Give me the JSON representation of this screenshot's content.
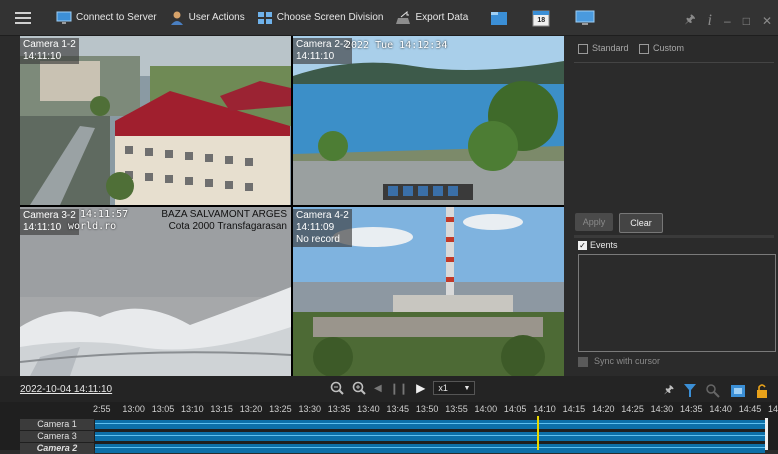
{
  "toolbar": {
    "connect_label": "Connect to Server",
    "user_actions_label": "User Actions",
    "screen_division_label": "Choose Screen Division",
    "export_label": "Export Data",
    "calendar_day": "18"
  },
  "cameras": [
    {
      "label": "Camera 1-2",
      "time": "14:11:10"
    },
    {
      "label": "Camera 2-2",
      "time": "14:11:10",
      "osd": "2022 Tue 14:12:34"
    },
    {
      "label": "Camera 3-2",
      "time": "14:11:10",
      "osd_left": "14:11:57",
      "osd_left2": "world.ro",
      "osd_right": "BAZA SALVAMONT ARGES",
      "osd_right2": "Cota 2000 Transfagarasan"
    },
    {
      "label": "Camera 4-2",
      "time": "14:11:09",
      "status": "No record"
    }
  ],
  "side": {
    "standard_label": "Standard",
    "custom_label": "Custom",
    "apply_label": "Apply",
    "clear_label": "Clear",
    "events_label": "Events",
    "sync_label": "Sync with cursor"
  },
  "playback": {
    "datetime": "2022-10-04 14:11:10",
    "speed": "x1"
  },
  "timeline": {
    "ticks": [
      "2:55",
      "13:00",
      "13:05",
      "13:10",
      "13:15",
      "13:20",
      "13:25",
      "13:30",
      "13:35",
      "13:40",
      "13:45",
      "13:50",
      "13:55",
      "14:00",
      "14:05",
      "14:10",
      "14:15",
      "14:20",
      "14:25",
      "14:30",
      "14:35",
      "14:40",
      "14:45",
      "14:5"
    ],
    "rows": [
      "Camera 1",
      "Camera 3",
      "Camera 2"
    ]
  },
  "colors": {
    "accent": "#2f8fd0",
    "track": "#0c6fa8",
    "cursor": "#e8d800"
  }
}
